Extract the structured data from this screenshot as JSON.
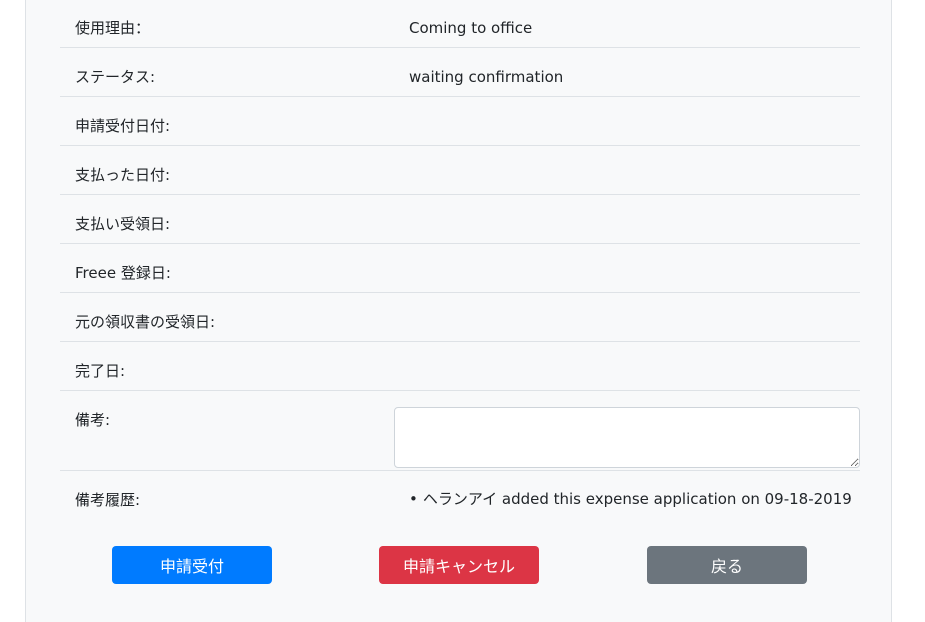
{
  "fields": [
    {
      "label": "使用理由：",
      "value": "Coming to office"
    },
    {
      "label": "ステータス:",
      "value": "waiting confirmation"
    },
    {
      "label": "申請受付日付:",
      "value": ""
    },
    {
      "label": "支払った日付:",
      "value": ""
    },
    {
      "label": "支払い受領日:",
      "value": ""
    },
    {
      "label": "Freee 登録日:",
      "value": ""
    },
    {
      "label": "元の領収書の受領日:",
      "value": ""
    },
    {
      "label": "完了日:",
      "value": ""
    }
  ],
  "notes": {
    "label": "備考:",
    "value": ""
  },
  "history": {
    "label": "備考履歴:",
    "entries": [
      "ヘランアイ added this expense application on 09-18-2019"
    ]
  },
  "buttons": {
    "accept": "申請受付",
    "cancel": "申請キャンセル",
    "back": "戻る"
  },
  "colors": {
    "primary": "#007bff",
    "danger": "#dc3545",
    "secondary": "#6c757d",
    "panel": "#f8f9fa"
  }
}
